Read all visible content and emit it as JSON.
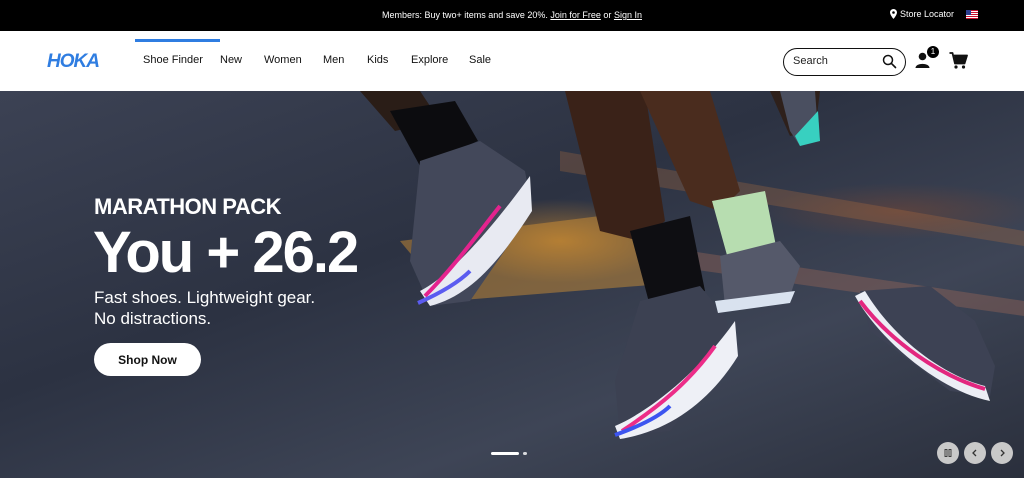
{
  "promo": {
    "text": "Members: Buy two+ items and save 20%.",
    "join_link": "Join for Free",
    "or_text": "or",
    "signin_link": "Sign In",
    "store_locator": "Store Locator"
  },
  "header": {
    "logo_text": "HOKA",
    "nav": [
      {
        "label": "Shoe Finder",
        "active": true
      },
      {
        "label": "New"
      },
      {
        "label": "Women"
      },
      {
        "label": "Men"
      },
      {
        "label": "Kids"
      },
      {
        "label": "Explore"
      },
      {
        "label": "Sale"
      }
    ],
    "search_placeholder": "Search",
    "account_badge": "1"
  },
  "hero": {
    "eyebrow": "MARATHON PACK",
    "headline": "You + 26.2",
    "subline_1": "Fast shoes. Lightweight gear.",
    "subline_2": "No distractions.",
    "cta": "Shop Now",
    "carousel_slides": 2,
    "carousel_active": 1
  },
  "colors": {
    "brand_blue": "#2f7de1",
    "promo_bg": "#000000",
    "hero_bg": "#353b4b"
  },
  "icons": [
    "location-pin-icon",
    "us-flag-icon",
    "search-icon",
    "account-icon",
    "cart-icon",
    "pause-icon",
    "chevron-left-icon",
    "chevron-right-icon"
  ]
}
